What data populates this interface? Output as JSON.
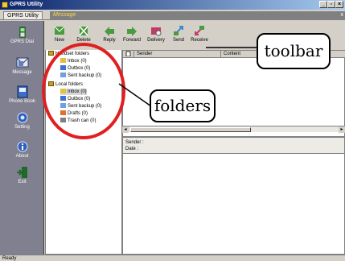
{
  "window": {
    "title": "GPRS Utility",
    "minimize": "_",
    "maximize": "▫",
    "close": "×"
  },
  "tabs": [
    {
      "label": "GPRS Utility"
    },
    {
      "label": "Message"
    }
  ],
  "tab_close": "x",
  "nav": [
    {
      "label": "GPRS Dial",
      "icon": "phone-icon"
    },
    {
      "label": "Message",
      "icon": "message-icon"
    },
    {
      "label": "Phone Book",
      "icon": "phonebook-icon"
    },
    {
      "label": "Setting",
      "icon": "setting-icon"
    },
    {
      "label": "About",
      "icon": "about-icon"
    },
    {
      "label": "Exit",
      "icon": "exit-icon"
    }
  ],
  "toolbar": [
    {
      "label": "New",
      "icon": "new-message-icon"
    },
    {
      "label": "Delete",
      "icon": "delete-icon"
    },
    {
      "label": "Reply",
      "icon": "reply-icon"
    },
    {
      "label": "Forward",
      "icon": "forward-icon"
    },
    {
      "label": "Delivery",
      "icon": "delivery-icon"
    },
    {
      "label": "Send",
      "icon": "send-icon"
    },
    {
      "label": "Receive",
      "icon": "receive-icon"
    }
  ],
  "folders": {
    "handset": {
      "label": "Handset folders",
      "items": [
        {
          "label": "Inbox (0)"
        },
        {
          "label": "Outbox (0)"
        },
        {
          "label": "Sent backup (0)"
        }
      ]
    },
    "local": {
      "label": "Local folders",
      "items": [
        {
          "label": "Inbox (0)"
        },
        {
          "label": "Outbox (0)"
        },
        {
          "label": "Sent backup (0)"
        },
        {
          "label": "Drafts (0)"
        },
        {
          "label": "Trash can (0)"
        }
      ]
    }
  },
  "list": {
    "columns": [
      "",
      "Sender",
      "Content"
    ]
  },
  "detail": {
    "sender_label": "Sender :",
    "date_label": "Date :"
  },
  "status": {
    "text": "Ready"
  },
  "annotations": {
    "toolbar": "toolbar",
    "folders": "folders"
  },
  "colors": {
    "nav_bg": "#808090",
    "tab_active": "#f7d94c",
    "title_start": "#0a246a",
    "annotation_circle": "#e02020"
  }
}
